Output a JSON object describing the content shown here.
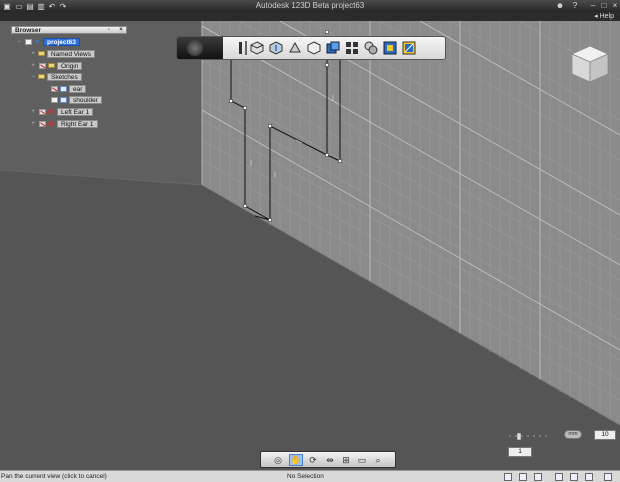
{
  "app": {
    "title": "Autodesk 123D Beta   project63"
  },
  "help": {
    "label": "Help",
    "arrow": "◂"
  },
  "browser": {
    "title": "Browser",
    "items": [
      {
        "label": "project63",
        "level": 0,
        "toggle": "−",
        "icon": "project-icon",
        "selected": true
      },
      {
        "label": "Named Views",
        "level": 1,
        "toggle": "+",
        "icon": "folder-icon",
        "selected": false
      },
      {
        "label": "Origin",
        "level": 1,
        "toggle": "+",
        "icon": "folder-icon",
        "selected": false
      },
      {
        "label": "Sketches",
        "level": 1,
        "toggle": "−",
        "icon": "folder-icon",
        "selected": false
      },
      {
        "label": "ear",
        "level": 2,
        "toggle": "",
        "icon": "sketch-icon",
        "selected": false
      },
      {
        "label": "shoulder",
        "level": 2,
        "toggle": "",
        "icon": "sketch-icon",
        "selected": false
      },
      {
        "label": "Left Ear 1",
        "level": 1,
        "toggle": "+",
        "icon": "body-icon",
        "selected": false
      },
      {
        "label": "Right Ear 1",
        "level": 1,
        "toggle": "+",
        "icon": "body-icon",
        "selected": false
      }
    ]
  },
  "grid": {
    "units": "mm",
    "spacing": "10",
    "snap": "1"
  },
  "status": {
    "hint": "Pan the current view (click to cancel)",
    "selection": "No Selection"
  },
  "colors": {
    "background": "#555555",
    "wall": "#8c8c8c",
    "selection": "#2f6fd6"
  }
}
